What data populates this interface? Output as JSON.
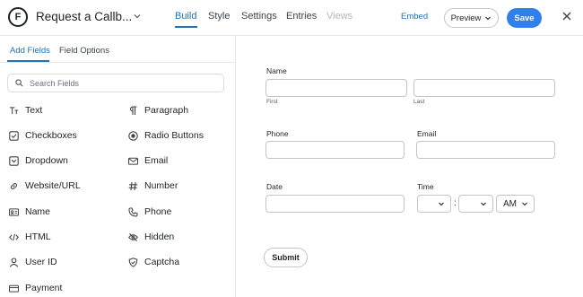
{
  "header": {
    "logo_letter": "F",
    "form_title": "Request a Callb...",
    "tabs": [
      {
        "label": "Build",
        "state": "active"
      },
      {
        "label": "Style",
        "state": "normal"
      },
      {
        "label": "Settings",
        "state": "normal"
      },
      {
        "label": "Entries",
        "state": "normal"
      },
      {
        "label": "Views",
        "state": "disabled"
      }
    ],
    "embed_label": "Embed",
    "preview_label": "Preview",
    "save_label": "Save"
  },
  "left_panel": {
    "tabs": [
      {
        "label": "Add Fields",
        "state": "active"
      },
      {
        "label": "Field Options",
        "state": "normal"
      }
    ],
    "search_placeholder": "Search Fields",
    "fields": [
      {
        "label": "Text",
        "icon": "text-icon"
      },
      {
        "label": "Paragraph",
        "icon": "paragraph-icon"
      },
      {
        "label": "Checkboxes",
        "icon": "checkbox-icon"
      },
      {
        "label": "Radio Buttons",
        "icon": "radio-icon"
      },
      {
        "label": "Dropdown",
        "icon": "dropdown-icon"
      },
      {
        "label": "Email",
        "icon": "email-icon"
      },
      {
        "label": "Website/URL",
        "icon": "link-icon"
      },
      {
        "label": "Number",
        "icon": "hash-icon"
      },
      {
        "label": "Name",
        "icon": "id-card-icon"
      },
      {
        "label": "Phone",
        "icon": "phone-icon"
      },
      {
        "label": "HTML",
        "icon": "code-icon"
      },
      {
        "label": "Hidden",
        "icon": "eye-slash-icon"
      },
      {
        "label": "User ID",
        "icon": "user-icon"
      },
      {
        "label": "Captcha",
        "icon": "shield-icon"
      },
      {
        "label": "Payment",
        "icon": "card-icon"
      }
    ]
  },
  "form": {
    "name_label": "Name",
    "first_sublabel": "First",
    "last_sublabel": "Last",
    "phone_label": "Phone",
    "email_label": "Email",
    "date_label": "Date",
    "time_label": "Time",
    "time_separator": ":",
    "ampm_value": "AM",
    "submit_label": "Submit"
  },
  "colors": {
    "accent": "#2271b1",
    "save_button": "#2f80ed"
  }
}
